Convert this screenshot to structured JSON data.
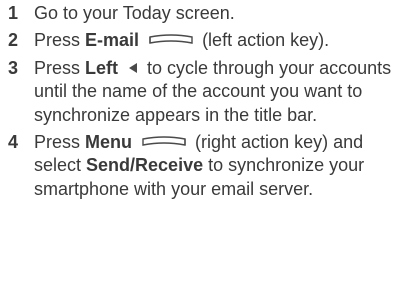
{
  "steps": [
    {
      "number": "1",
      "text": "Go to your Today screen."
    },
    {
      "number": "2",
      "pre": "Press ",
      "key": "E-mail",
      "icon": "left-action-key-icon",
      "post": " (left action key)."
    },
    {
      "number": "3",
      "pre": "Press ",
      "key": "Left",
      "icon": "left-arrow-icon",
      "post": " to cycle through your accounts until the name of the account you want to synchronize appears in the title bar."
    },
    {
      "number": "4",
      "pre": "Press ",
      "key": "Menu",
      "icon": "right-action-key-icon",
      "mid": " (right action key) and select ",
      "key2": "Send/Receive",
      "post": " to synchronize your smartphone with your email server."
    }
  ]
}
